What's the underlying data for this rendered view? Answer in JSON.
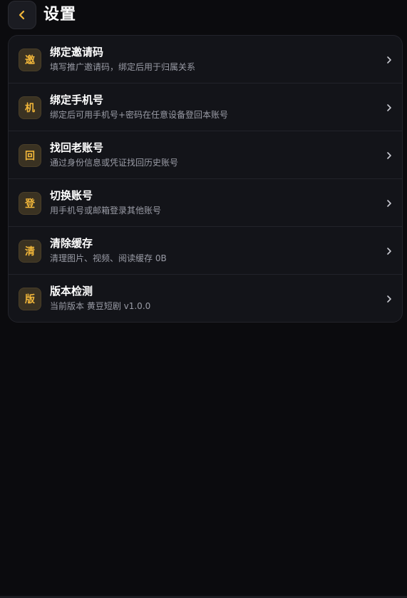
{
  "header": {
    "title": "设置",
    "back_icon": "chevron-left-icon"
  },
  "colors": {
    "background": "#0b0b0e",
    "card": "#131419",
    "accent": "#f2b73a",
    "badge_bg": "#3a3222",
    "subtext": "#9a9ca6"
  },
  "settings": {
    "items": [
      {
        "badge": "邀",
        "title": "绑定邀请码",
        "desc": "填写推广邀请码，绑定后用于归属关系"
      },
      {
        "badge": "机",
        "title": "绑定手机号",
        "desc": "绑定后可用手机号+密码在任意设备登回本账号"
      },
      {
        "badge": "回",
        "title": "找回老账号",
        "desc": "通过身份信息或凭证找回历史账号"
      },
      {
        "badge": "登",
        "title": "切换账号",
        "desc": "用手机号或邮箱登录其他账号"
      },
      {
        "badge": "清",
        "title": "清除缓存",
        "desc": "清理图片、视频、阅读缓存 0B"
      },
      {
        "badge": "版",
        "title": "版本检测",
        "desc": "当前版本 黄豆短剧 v1.0.0"
      }
    ]
  }
}
